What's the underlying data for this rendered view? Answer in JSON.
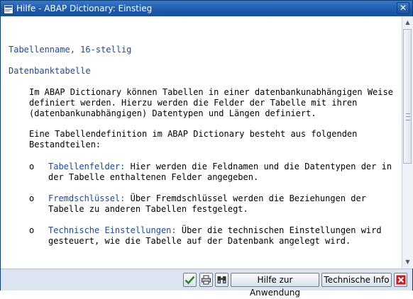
{
  "window": {
    "title": "Hilfe - ABAP Dictionary: Einstieg"
  },
  "content": {
    "field_label": "Tabellenname, 16-stellig",
    "object_type": "Datenbanktabelle",
    "intro_lines": [
      "Im ABAP Dictionary können Tabellen in einer datenbankunabhängigen Weise",
      "definiert werden. Hierzu werden die Felder der Tabelle mit ihren",
      "(datenbankunabhängigen) Datentypen und Längen definiert."
    ],
    "parts_lines": [
      "Eine Tabellendefinition im ABAP Dictionary besteht aus folgenden",
      "Bestandteilen:"
    ],
    "bullets": [
      {
        "marker": "o",
        "term": "Tabellenfelder:",
        "line1": " Hier werden die Feldnamen und die Datentypen der in",
        "line2": "der Tabelle enthaltenen Felder angegeben."
      },
      {
        "marker": "o",
        "term": "Fremdschlüssel:",
        "line1": " Über Fremdschlüssel werden die Beziehungen der",
        "line2": "Tabelle zu anderen Tabellen festgelegt."
      },
      {
        "marker": "o",
        "term": "Technische Einstellungen:",
        "line1": " Über die technischen Einstellungen wird",
        "line2": "gesteuert, wie die Tabelle auf der Datenbank angelegt wird."
      }
    ]
  },
  "footer": {
    "help_on_app_label": "Hilfe zur Anwendung",
    "tech_info_label": "Technische Info"
  },
  "colors": {
    "title_bar": "#1f5cae",
    "link_blue": "#1a4aa6",
    "ok_green": "#2c8a1a",
    "cancel_red": "#d01818"
  }
}
